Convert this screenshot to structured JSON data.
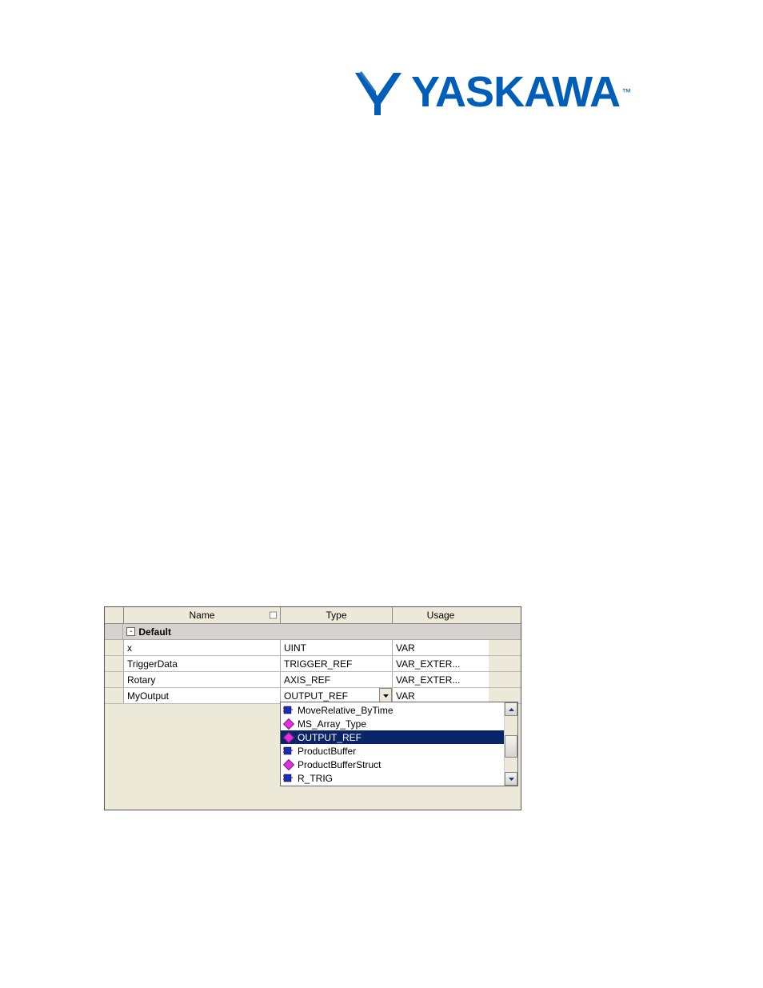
{
  "brand": {
    "name": "YASKAWA",
    "tm": "™"
  },
  "grid": {
    "headers": {
      "name": "Name",
      "type": "Type",
      "usage": "Usage"
    },
    "group_label": "Default",
    "group_toggle": "-",
    "rows": [
      {
        "name": "x",
        "type": "UINT",
        "usage": "VAR"
      },
      {
        "name": "TriggerData",
        "type": "TRIGGER_REF",
        "usage": "VAR_EXTER..."
      },
      {
        "name": "Rotary",
        "type": "AXIS_REF",
        "usage": "VAR_EXTER..."
      },
      {
        "name": "MyOutput",
        "type": "OUTPUT_REF",
        "usage": "VAR"
      }
    ]
  },
  "dropdown": {
    "items": [
      {
        "label": "MoveRelative_ByTime",
        "icon": "fb"
      },
      {
        "label": "MS_Array_Type",
        "icon": "struct"
      },
      {
        "label": "OUTPUT_REF",
        "icon": "struct",
        "selected": true
      },
      {
        "label": "ProductBuffer",
        "icon": "fb"
      },
      {
        "label": "ProductBufferStruct",
        "icon": "struct"
      },
      {
        "label": "R_TRIG",
        "icon": "fb"
      }
    ]
  }
}
